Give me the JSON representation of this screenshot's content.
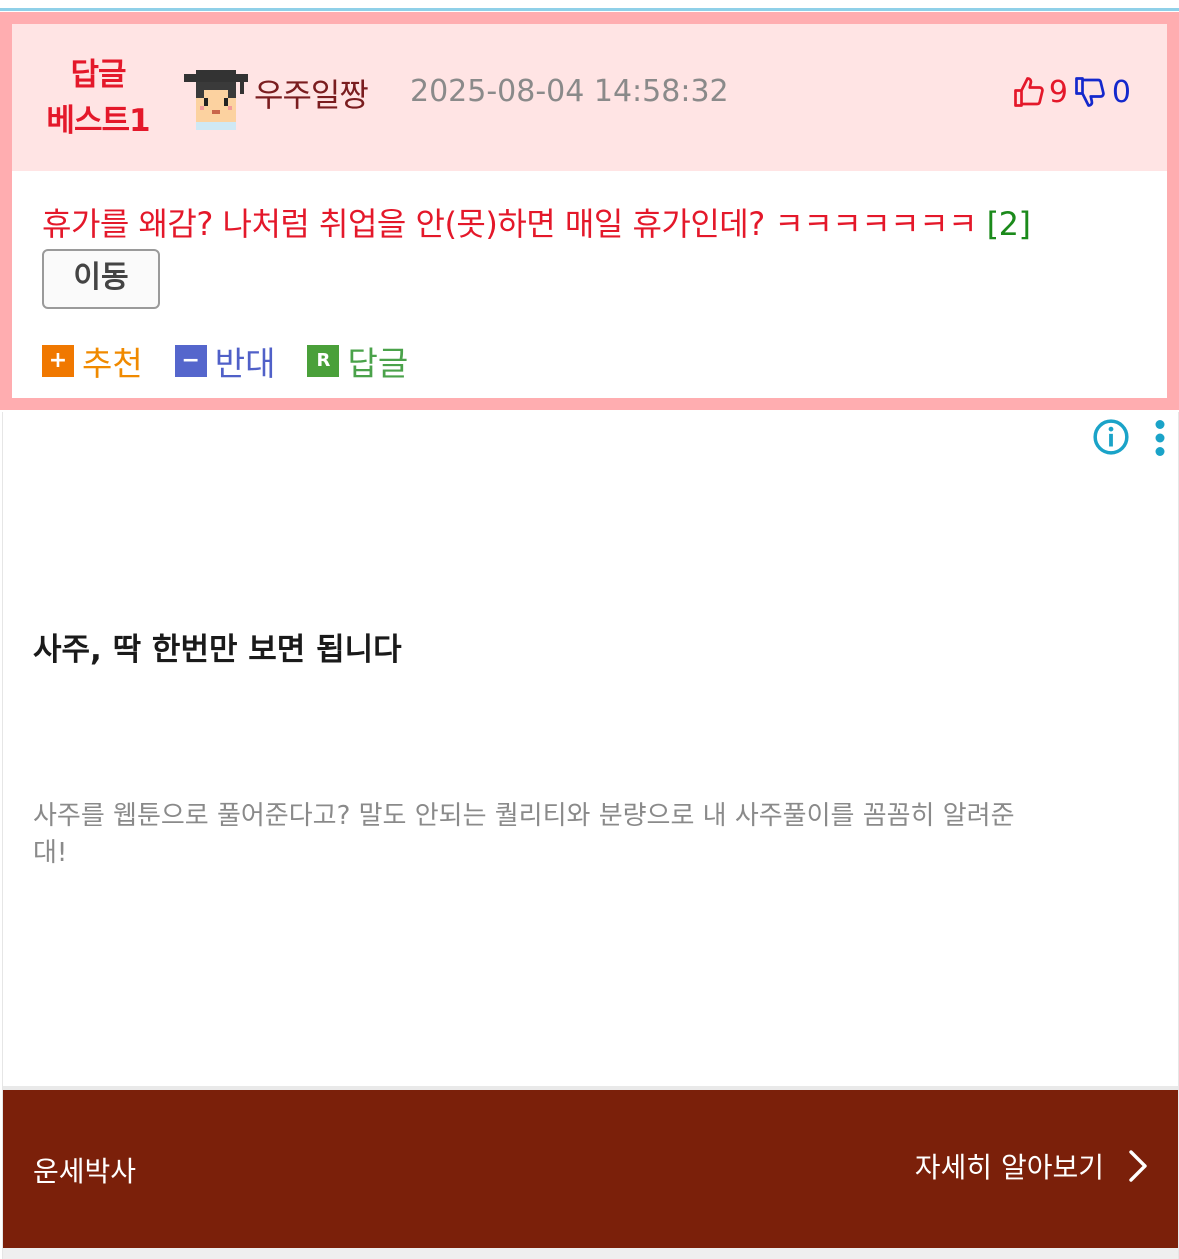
{
  "best_reply": {
    "label_line1": "답글",
    "label_line2": "베스트1",
    "nickname": "우주일짱",
    "date": "2025-08-04 14:58:32",
    "up_count": "9",
    "down_count": "0",
    "comment_text": "휴가를 왜감? 나처럼 취업을 안(못)하면 매일 휴가인데? ㅋㅋㅋㅋㅋㅋㅋ ",
    "comment_count": "[2]",
    "move_button": "이동",
    "actions": {
      "recommend_icon": "+",
      "recommend": "추천",
      "oppose_icon": "−",
      "oppose": "반대",
      "reply_icon": "R",
      "reply": "답글"
    },
    "colors": {
      "accent_red": "#e4182a",
      "card_border": "#ffadb0",
      "header_bg": "#ffe4e4"
    }
  },
  "ad": {
    "title": "사주, 딱 한번만 보면 됩니다",
    "description": "사주를 웹툰으로 풀어준다고? 말도 안되는 퀄리티와 분량으로 내 사주풀이를 꼼꼼히 알려준대!",
    "brand": "운세박사",
    "cta": "자세히 알아보기",
    "icons": [
      "info-icon",
      "more-vertical-icon",
      "chevron-right-icon"
    ],
    "colors": {
      "bar_bg": "#7b200a",
      "info": "#1aa3c8"
    }
  }
}
